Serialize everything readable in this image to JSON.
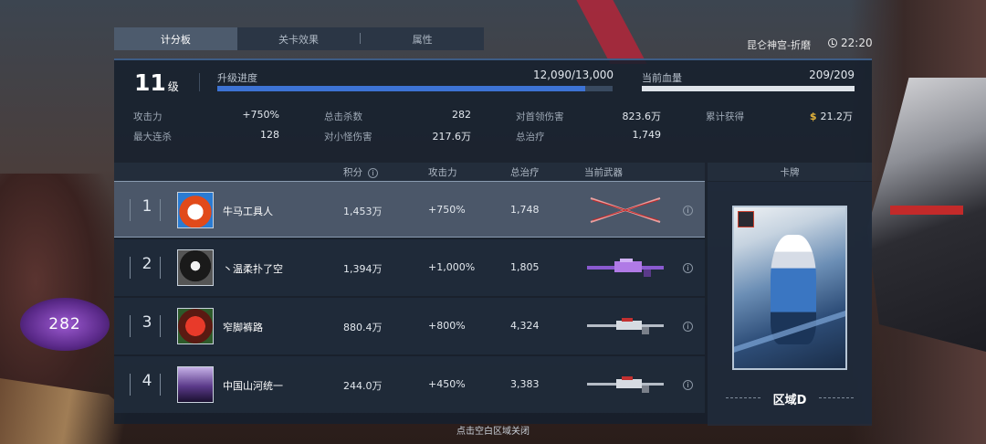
{
  "tabs": [
    {
      "label": "计分板",
      "active": true
    },
    {
      "label": "关卡效果",
      "active": false
    },
    {
      "label": "属性",
      "active": false
    }
  ],
  "location": "昆仑神宫-折磨",
  "time": "22:20",
  "level": {
    "number": "11",
    "unit": "级"
  },
  "progress": {
    "label": "升级进度",
    "value": "12,090/13,000",
    "fraction": 0.93
  },
  "hp": {
    "label": "当前血量",
    "value": "209/209",
    "fraction": 1.0
  },
  "stats": [
    {
      "label": "攻击力",
      "value": "+750%"
    },
    {
      "label": "总击杀数",
      "value": "282"
    },
    {
      "label": "对首领伤害",
      "value": "823.6万"
    },
    {
      "label": "累计获得",
      "value": "21.2万",
      "icon": "coin-icon"
    },
    {
      "label": "最大连杀",
      "value": "128"
    },
    {
      "label": "对小怪伤害",
      "value": "217.6万"
    },
    {
      "label": "总治疗",
      "value": "1,749"
    }
  ],
  "table": {
    "headers": {
      "score": "积分",
      "attack": "攻击力",
      "heal": "总治疗",
      "weapon": "当前武器",
      "card": "卡牌"
    },
    "rows": [
      {
        "rank": "1",
        "name": "牛马工具人",
        "score": "1,453万",
        "attack": "+750%",
        "heal": "1,748",
        "avatar": "fox-avatar",
        "weapon": "dual-blades-icon",
        "selected": true
      },
      {
        "rank": "2",
        "name": "丶温柔扑了空",
        "score": "1,394万",
        "attack": "+1,000%",
        "heal": "1,805",
        "avatar": "ghost-avatar",
        "weapon": "purple-sniper-icon",
        "selected": false
      },
      {
        "rank": "3",
        "name": "窄脚裤路",
        "score": "880.4万",
        "attack": "+800%",
        "heal": "4,324",
        "avatar": "red-cat-avatar",
        "weapon": "silver-rifle-icon",
        "selected": false
      },
      {
        "rank": "4",
        "name": "中国山河统一",
        "score": "244.0万",
        "attack": "+450%",
        "heal": "3,383",
        "avatar": "girl-avatar",
        "weapon": "silver-rifle-icon",
        "selected": false
      }
    ]
  },
  "card": {
    "label": "区域D"
  },
  "hud": {
    "crystal_count": "282"
  },
  "footer": "点击空白区域关闭",
  "colors": {
    "progress": "#3d73d4",
    "hp": "#dfe4ea",
    "coin": "#e5b43a",
    "accent": "#3d5d86"
  }
}
